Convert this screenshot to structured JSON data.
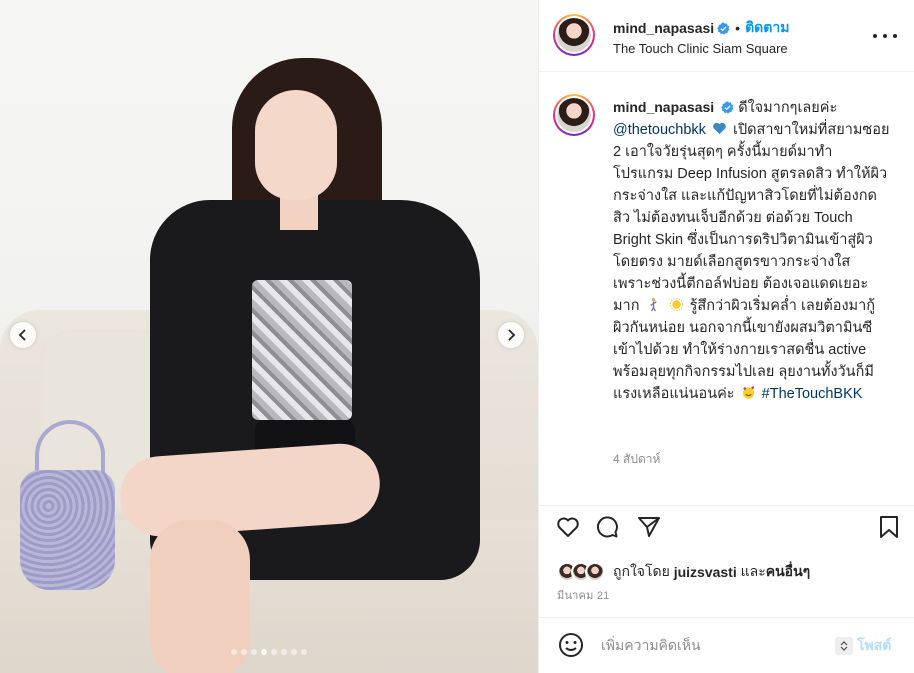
{
  "post": {
    "username": "mind_napasasi",
    "follow_label": "ติดตาม",
    "separator": "•",
    "location": "The Touch Clinic Siam Square",
    "carousel": {
      "total_slides": 8,
      "active_slide": 4
    }
  },
  "caption": {
    "username": "mind_napasasi",
    "part1": "ดีใจมากๆเลยค่ะ",
    "mention": "@thetouchbkk",
    "part2": "เปิดสาขาใหม่ที่สยามซอย 2 เอาใจวัยรุ่นสุดๆ ครั้งนี้มายด์มาทำโปรแกรม Deep Infusion สูตรลดสิว ทำให้ผิวกระจ่างใส และแก้ปัญหาสิวโดยที่ไม่ต้องกดสิว ไม่ต้องทนเจ็บอีกด้วย ต่อด้วย Touch Bright Skin ซึ่งเป็นการดริปวิตามินเข้าสู่ผิวโดยตรง มายด์เลือกสูตรขาวกระจ่างใส เพราะช่วงนี้ตีกอล์ฟบ่อย ต้องเจอแดดเยอะมาก",
    "part3": "รู้สึกว่าผิวเริ่มคล่ำ เลยต้องมากู้ผิวกันหน่อย นอกจากนี้เขายังผสมวิตามินซีเข้าไปด้วย ทำให้ร่างกายเราสดชื่น active พร้อมลุยทุกกิจกรรมไปเลย ลุยงานทั้งวันก็มีแรงเหลือแน่นอนค่ะ",
    "hashtag": "#TheTouchBKK",
    "time_ago": "4 สัปดาห์"
  },
  "likes": {
    "prefix": "ถูกใจโดย",
    "user": "juizsvasti",
    "connector": "และ",
    "others": "คนอื่นๆ"
  },
  "date": "มีนาคม 21",
  "comment": {
    "placeholder": "เพิ่มความคิดเห็น",
    "post_label": "โพสต์"
  },
  "icons": {
    "verified": "verified-badge-icon",
    "more": "more-options-icon",
    "like": "heart-icon",
    "comment": "comment-icon",
    "share": "paper-plane-icon",
    "save": "bookmark-icon",
    "emoji": "smiley-icon",
    "prev": "chevron-left-icon",
    "next": "chevron-right-icon"
  },
  "colors": {
    "accent": "#0095f6",
    "link": "#00376b",
    "muted": "#8e8e8e",
    "text": "#262626",
    "verified": "#3897f0"
  }
}
